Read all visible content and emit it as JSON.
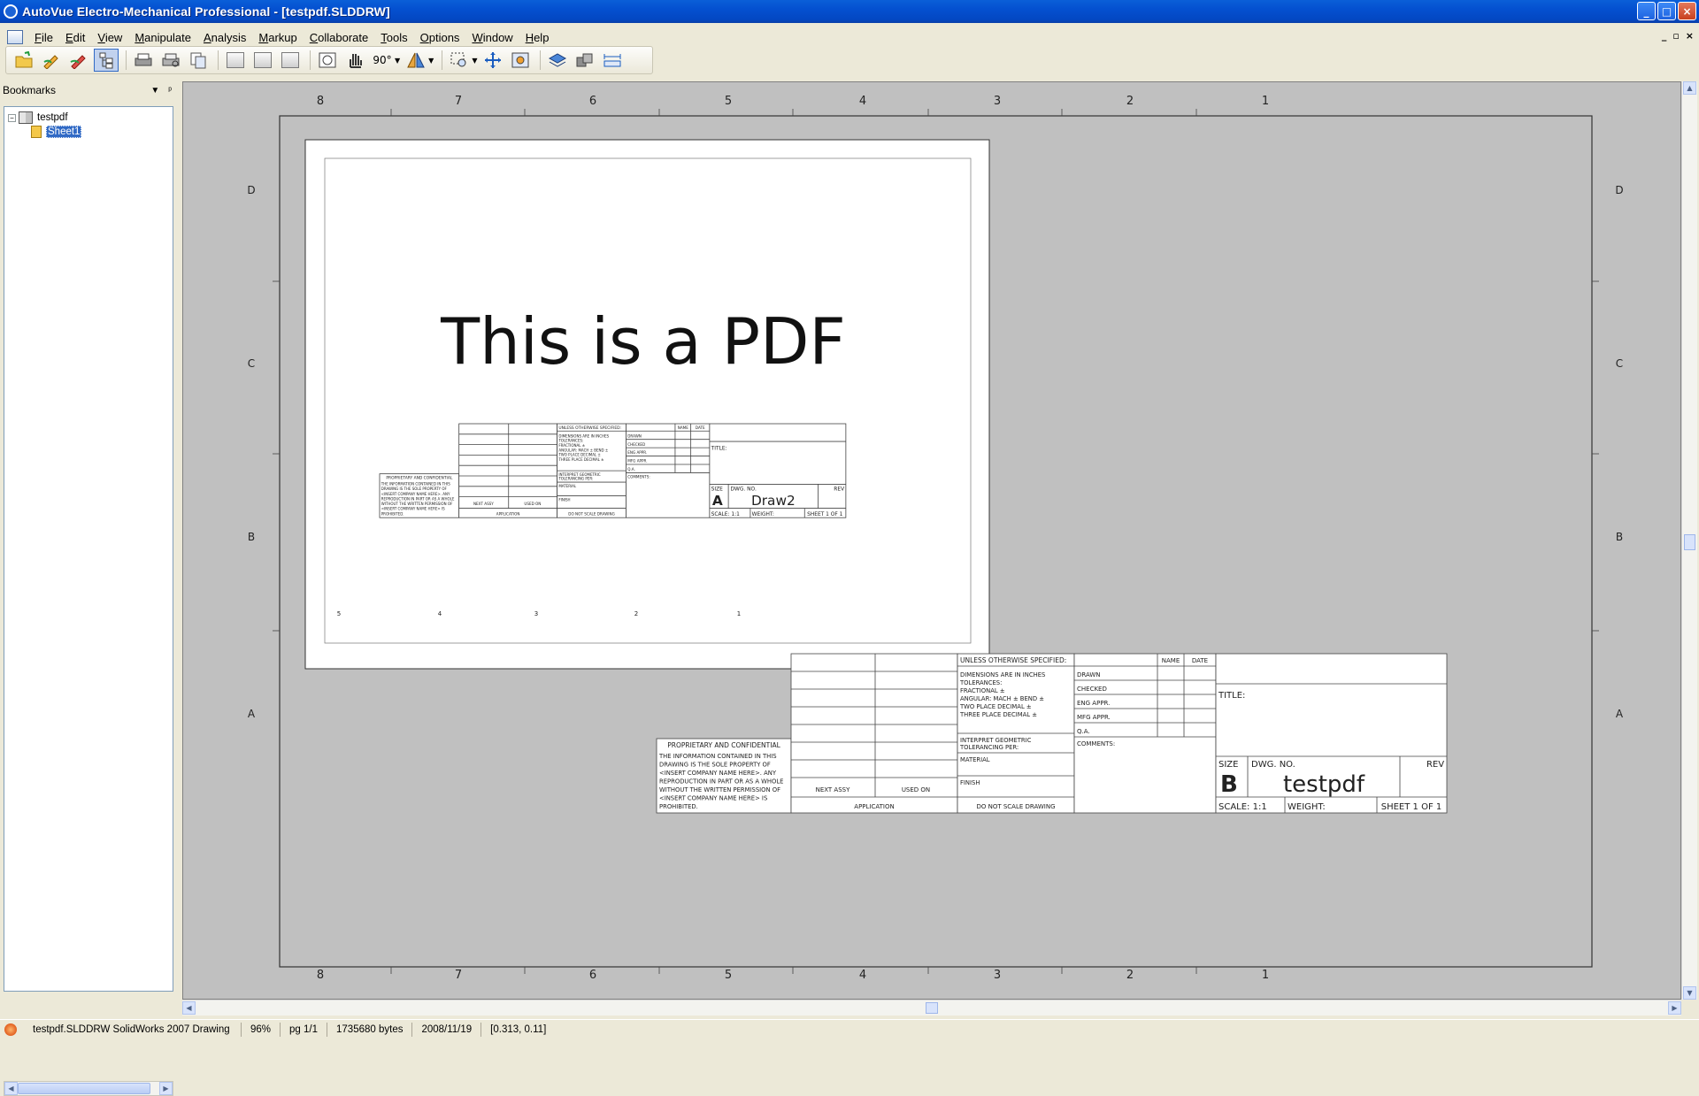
{
  "window": {
    "title": "AutoVue Electro-Mechanical Professional - [testpdf.SLDDRW]",
    "buttons": {
      "minimize": "_",
      "maximize": "□",
      "close": "×"
    }
  },
  "menu": {
    "items": [
      "File",
      "Edit",
      "View",
      "Manipulate",
      "Analysis",
      "Markup",
      "Collaborate",
      "Tools",
      "Options",
      "Window",
      "Help"
    ],
    "mdi": {
      "minimize": "_",
      "restore": "▫",
      "close": "×"
    }
  },
  "toolbar": {
    "rotate_label": "90°"
  },
  "bookmarks": {
    "title": "Bookmarks",
    "dropdown": "▼",
    "pin": "ᵖ",
    "tree": {
      "toggle": "−",
      "root": "testpdf",
      "child": "Sheet1"
    }
  },
  "drawing": {
    "zone_columns": [
      "8",
      "7",
      "6",
      "5",
      "4",
      "3",
      "2",
      "1"
    ],
    "zone_rows": [
      "D",
      "C",
      "B",
      "A"
    ],
    "outer_title_block": {
      "unless": "UNLESS OTHERWISE SPECIFIED:",
      "name": "NAME",
      "date": "DATE",
      "dimensions": "DIMENSIONS ARE IN INCHES",
      "tolerances": "TOLERANCES:",
      "fractional": "FRACTIONAL ±",
      "angular": "ANGULAR: MACH ±    BEND ±",
      "two_place": "TWO PLACE DECIMAL    ±",
      "three_place": "THREE PLACE DECIMAL  ±",
      "interpret": "INTERPRET GEOMETRIC",
      "tolerancing": "TOLERANCING PER:",
      "material": "MATERIAL",
      "finish": "FINISH",
      "drawn": "DRAWN",
      "checked": "CHECKED",
      "eng_appr": "ENG APPR.",
      "mfg_appr": "MFG APPR.",
      "qa": "Q.A.",
      "comments": "COMMENTS:",
      "title": "TITLE:",
      "size_label": "SIZE",
      "size": "B",
      "dwg_no_label": "DWG.  NO.",
      "dwg_no": "testpdf",
      "rev": "REV",
      "scale": "SCALE: 1:1",
      "weight": "WEIGHT:",
      "sheet": "SHEET 1 OF 1",
      "next_assy": "NEXT ASSY",
      "used_on": "USED ON",
      "application": "APPLICATION",
      "do_not_scale": "DO NOT SCALE DRAWING",
      "proprietary_title": "PROPRIETARY AND CONFIDENTIAL",
      "proprietary_lines": [
        "THE INFORMATION CONTAINED IN THIS",
        "DRAWING IS THE SOLE PROPERTY OF",
        "<INSERT COMPANY NAME HERE>. ANY",
        "REPRODUCTION IN PART OR AS A WHOLE",
        "WITHOUT THE WRITTEN PERMISSION OF",
        "<INSERT COMPANY NAME HERE> IS",
        "PROHIBITED."
      ]
    },
    "inner_sheet": {
      "headline": "This is a PDF",
      "size": "A",
      "dwg_no": "Draw2",
      "zone_numbers": [
        "5",
        "4",
        "3",
        "2",
        "1"
      ],
      "unless": "UNLESS OTHERWISE SPECIFIED:",
      "name": "NAME",
      "date": "DATE",
      "dimensions": "DIMENSIONS ARE IN INCHES",
      "tolerances": "TOLERANCES:",
      "fractional": "FRACTIONAL ±",
      "angular": "ANGULAR: MACH ±    BEND ±",
      "two_place": "TWO PLACE DECIMAL    ±",
      "three_place": "THREE PLACE DECIMAL  ±",
      "interpret": "INTERPRET GEOMETRIC",
      "tolerancing": "TOLERANCING PER:",
      "material": "MATERIAL",
      "finish": "FINISH",
      "drawn": "DRAWN",
      "checked": "CHECKED",
      "eng_appr": "ENG APPR.",
      "mfg_appr": "MFG APPR.",
      "qa": "Q.A.",
      "comments": "COMMENTS:",
      "title": "TITLE:",
      "size_label": "SIZE",
      "dwg_no_label": "DWG.  NO.",
      "rev": "REV",
      "scale": "SCALE: 1:1",
      "weight": "WEIGHT:",
      "sheet": "SHEET 1 OF 1",
      "next_assy": "NEXT ASSY",
      "used_on": "USED ON",
      "application": "APPLICATION",
      "do_not_scale": "DO NOT SCALE DRAWING",
      "proprietary_title": "PROPRIETARY AND CONFIDENTIAL",
      "proprietary_lines": [
        "THE INFORMATION CONTAINED IN THIS",
        "DRAWING IS THE SOLE PROPERTY OF",
        "<INSERT COMPANY NAME HERE>. ANY",
        "REPRODUCTION IN PART OR AS A WHOLE",
        "WITHOUT THE WRITTEN PERMISSION OF",
        "<INSERT COMPANY NAME HERE> IS",
        "PROHIBITED."
      ]
    }
  },
  "statusbar": {
    "file": "testpdf.SLDDRW SolidWorks 2007 Drawing",
    "zoom": "96%",
    "page": "pg 1/1",
    "size": "1735680 bytes",
    "date": "2008/11/19",
    "coords": "[0.313, 0.11]"
  },
  "colors": {
    "titlebar": "#0450d0",
    "viewport_bg": "#c0c0c0",
    "selection": "#316ac5"
  },
  "icons": [
    "open-icon",
    "markup-pencil-icon",
    "markup-red-pencil-icon",
    "tree-view-icon",
    "print-icon",
    "print-preview-icon",
    "copy-icon",
    "prev-page-icon",
    "page-icon",
    "next-page-icon",
    "fit-icon",
    "pan-hand-icon",
    "rotate-icon",
    "mirror-icon",
    "zoom-box-icon",
    "fit-all-icon",
    "magnify-icon",
    "layers-icon",
    "blocks-icon",
    "measure-icon"
  ]
}
